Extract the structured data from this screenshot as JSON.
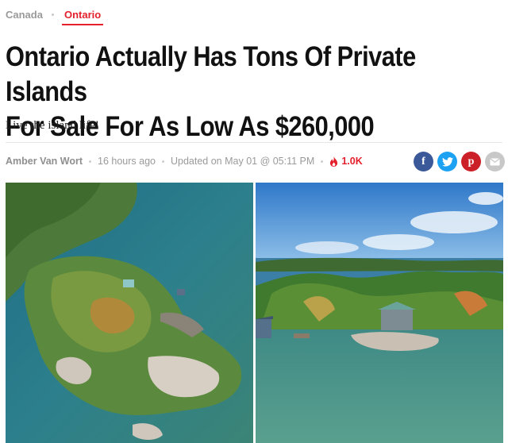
{
  "breadcrumb": {
    "parent": "Canada",
    "current": "Ontario"
  },
  "article": {
    "headline_line1": "Ontario Actually Has Tons Of Private Islands",
    "headline_line2": "For Sale For As Low As $260,000",
    "subtitle": "Live the island life!",
    "author": "Amber Van Wort",
    "published": "16 hours ago",
    "updated": "Updated on May 01 @ 05:11 PM",
    "views": "1.0K"
  },
  "share": {
    "facebook_glyph": "f",
    "pinterest_glyph": "p",
    "icons": [
      "facebook-icon",
      "twitter-icon",
      "pinterest-icon",
      "email-icon"
    ]
  },
  "colors": {
    "accent": "#e4202d",
    "facebook": "#3b5998",
    "twitter": "#1da1f2",
    "pinterest": "#cb2027",
    "email": "#c8c8c8"
  }
}
